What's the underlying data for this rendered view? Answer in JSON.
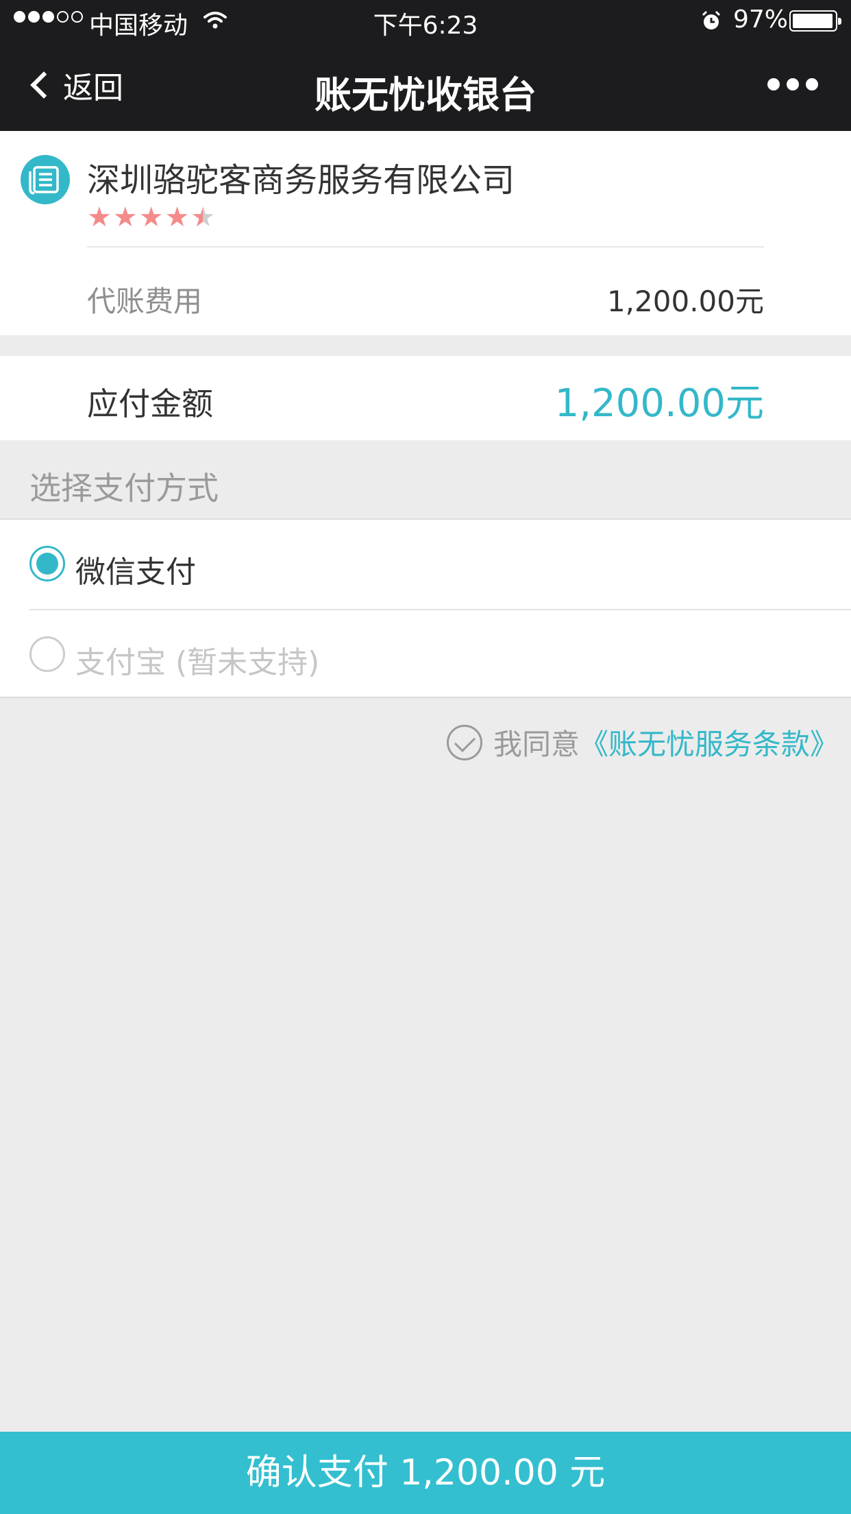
{
  "status_bar": {
    "carrier": "中国移动",
    "signal_bars": 3,
    "signal_total": 5,
    "time": "下午6:23",
    "battery": "97%",
    "battery_level": 0.97
  },
  "nav": {
    "back_label": "返回",
    "title": "账无忧收银台"
  },
  "merchant": {
    "name": "深圳骆驼客商务服务有限公司",
    "rating": 4.5,
    "rating_max": 5,
    "fee_label": "代账费用",
    "fee_value": "1,200.00元"
  },
  "payable": {
    "label": "应付金额",
    "value": "1,200.00元"
  },
  "payment": {
    "section_title": "选择支付方式",
    "methods": [
      {
        "label": "微信支付",
        "selected": true,
        "enabled": true
      },
      {
        "label": "支付宝 (暂未支持)",
        "selected": false,
        "enabled": false
      }
    ]
  },
  "agreement": {
    "text": "我同意",
    "link": "《账无忧服务条款》"
  },
  "confirm": {
    "label": "确认支付 1,200.00 元"
  },
  "colors": {
    "accent": "#33b8c9",
    "button": "#33bfcf",
    "header": "#1c1c1e",
    "star": "#f58a8a"
  }
}
